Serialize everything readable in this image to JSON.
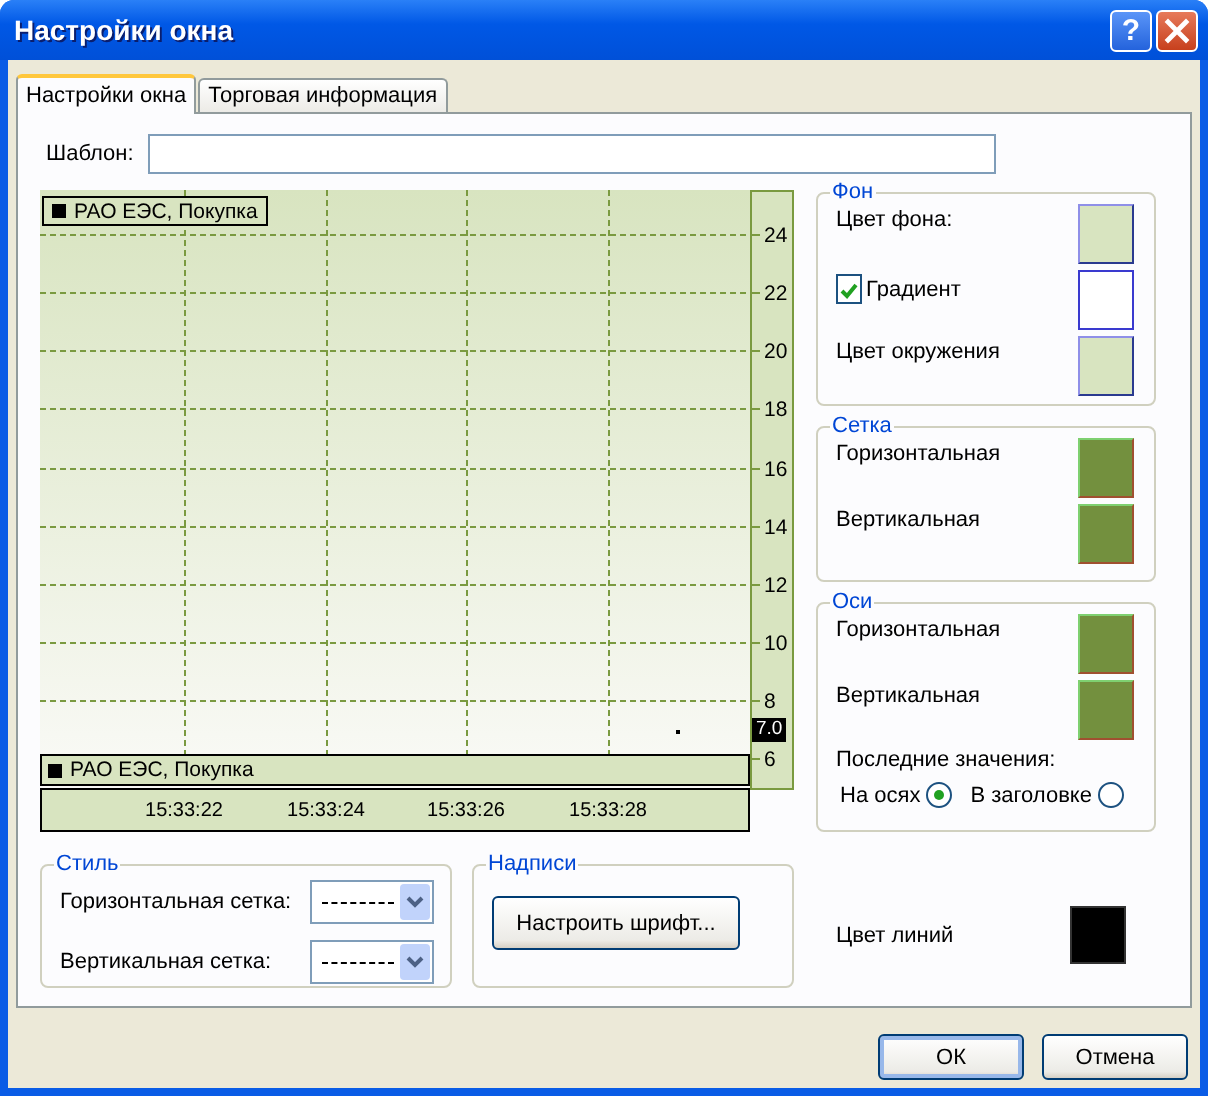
{
  "window": {
    "title": "Настройки окна",
    "help": "?"
  },
  "tabs": [
    {
      "label": "Настройки окна",
      "selected": true
    },
    {
      "label": "Торговая информация",
      "selected": false
    }
  ],
  "template_label": "Шаблон:",
  "preview": {
    "legend_top": "РАО ЕЭС, Покупка",
    "legend_bottom": "РАО ЕЭС, Покупка",
    "y_labels": [
      "24",
      "22",
      "20",
      "18",
      "16",
      "14",
      "12",
      "10",
      "8",
      "6"
    ],
    "x_labels": [
      "15:33:22",
      "15:33:24",
      "15:33:26",
      "15:33:28"
    ],
    "last_value": "7.0"
  },
  "background_group": {
    "title": "Фон",
    "rows": [
      {
        "kind": "color",
        "label": "Цвет фона:",
        "color": "#d8e4c0"
      },
      {
        "kind": "checkbox",
        "label": "Градиент",
        "checked": true,
        "color": "#ffffff"
      },
      {
        "kind": "color",
        "label": "Цвет окружения",
        "color": "#d8e4c0"
      }
    ]
  },
  "grid_group": {
    "title": "Сетка",
    "rows": [
      {
        "label": "Горизонтальная",
        "color": "#73903e"
      },
      {
        "label": "Вертикальная",
        "color": "#73903e"
      }
    ]
  },
  "axes_group": {
    "title": "Оси",
    "rows": [
      {
        "label": "Горизонтальная",
        "color": "#73903e"
      },
      {
        "label": "Вертикальная",
        "color": "#73903e"
      }
    ],
    "last_values_label": "Последние значения:",
    "options": [
      {
        "label": "На осях",
        "selected": true
      },
      {
        "label": "В заголовке",
        "selected": false
      }
    ]
  },
  "style_group": {
    "title": "Стиль",
    "rows": [
      {
        "label": "Горизонтальная сетка:"
      },
      {
        "label": "Вертикальная сетка:"
      }
    ]
  },
  "labels_group": {
    "title": "Надписи",
    "button": "Настроить шрифт..."
  },
  "line_color": {
    "label": "Цвет линий",
    "color": "#000000"
  },
  "buttons": [
    {
      "label": "ОК",
      "default": true
    },
    {
      "label": "Отмена",
      "default": false
    }
  ]
}
